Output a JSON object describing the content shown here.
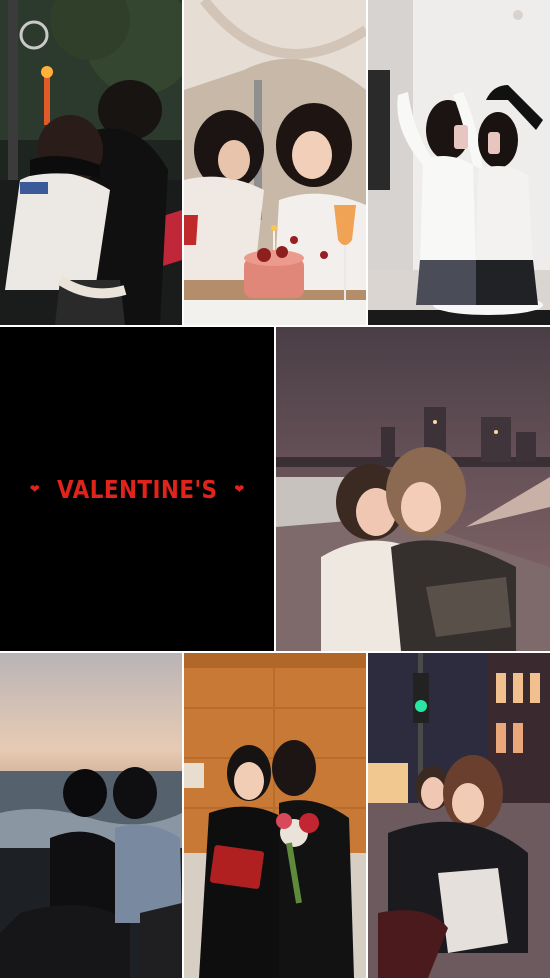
{
  "collage": {
    "title_text": "VALENTINE'S",
    "heart_icon": "heart-icon",
    "accent_color": "#e0241c",
    "photos": [
      {
        "name": "friends-hugging-night-street",
        "palette": [
          "#2a2e28",
          "#ece6e0"
        ]
      },
      {
        "name": "friends-laughing-cake-dinner",
        "palette": [
          "#b9a694",
          "#d9775e"
        ]
      },
      {
        "name": "mirror-selfie-two-friends",
        "palette": [
          "#cfc7c3",
          "#f4f2f0"
        ]
      },
      {
        "name": "friends-hug-city-skyline",
        "palette": [
          "#5c4d55",
          "#f2d2c2"
        ]
      },
      {
        "name": "friends-sunset-beach",
        "palette": [
          "#d3c3b8",
          "#13171c"
        ]
      },
      {
        "name": "graduation-kiss",
        "palette": [
          "#cf7d3a",
          "#101010"
        ]
      },
      {
        "name": "friends-hug-city-street-night",
        "palette": [
          "#2a2a3a",
          "#d9a596"
        ]
      }
    ]
  }
}
